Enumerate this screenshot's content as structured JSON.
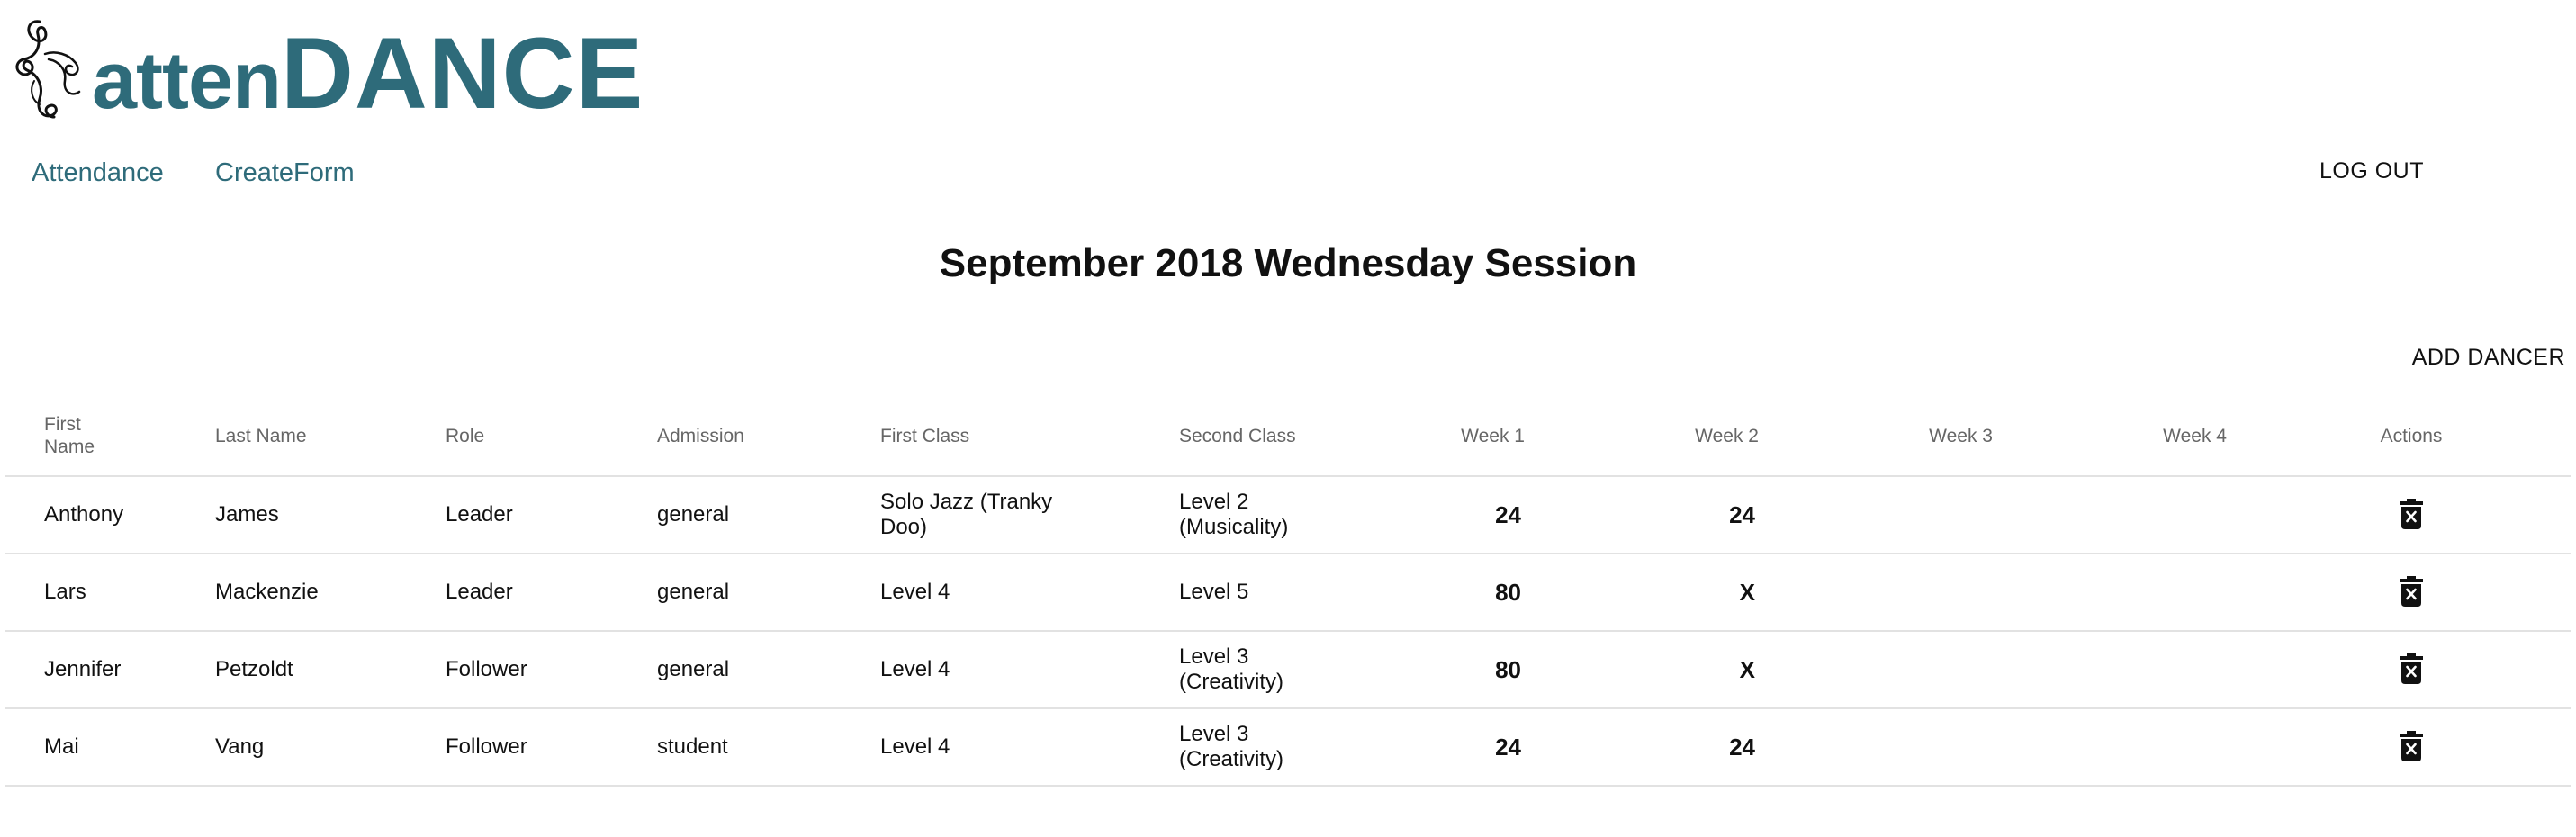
{
  "logo": {
    "text_small": "atten",
    "text_big": "DANCE"
  },
  "nav": {
    "attendance": "Attendance",
    "create_form": "CreateForm",
    "logout": "LOG OUT"
  },
  "page": {
    "title": "September 2018 Wednesday Session",
    "add_dancer": "ADD DANCER"
  },
  "table": {
    "headers": {
      "first_name_line1": "First",
      "first_name_line2": "Name",
      "last_name": "Last Name",
      "role": "Role",
      "admission": "Admission",
      "first_class": "First Class",
      "second_class": "Second Class",
      "week1": "Week 1",
      "week2": "Week 2",
      "week3": "Week 3",
      "week4": "Week 4",
      "actions": "Actions"
    },
    "rows": [
      {
        "first_name": "Anthony",
        "last_name": "James",
        "role": "Leader",
        "admission": "general",
        "first_class": "Solo Jazz (Tranky Doo)",
        "second_class": "Level 2 (Musicality)",
        "week1": "24",
        "week2": "24",
        "week3": "",
        "week4": ""
      },
      {
        "first_name": "Lars",
        "last_name": "Mackenzie",
        "role": "Leader",
        "admission": "general",
        "first_class": "Level 4",
        "second_class": "Level 5",
        "week1": "80",
        "week2": "X",
        "week3": "",
        "week4": ""
      },
      {
        "first_name": "Jennifer",
        "last_name": "Petzoldt",
        "role": "Follower",
        "admission": "general",
        "first_class": "Level 4",
        "second_class": "Level 3 (Creativity)",
        "week1": "80",
        "week2": "X",
        "week3": "",
        "week4": ""
      },
      {
        "first_name": "Mai",
        "last_name": "Vang",
        "role": "Follower",
        "admission": "student",
        "first_class": "Level 4",
        "second_class": "Level 3 (Creativity)",
        "week1": "24",
        "week2": "24",
        "week3": "",
        "week4": ""
      }
    ]
  },
  "icons": {
    "delete": "delete-forever-icon"
  },
  "colors": {
    "brand": "#2e6b7a",
    "text": "#111111",
    "header_text": "#666666",
    "divider": "#e2e2e2"
  }
}
